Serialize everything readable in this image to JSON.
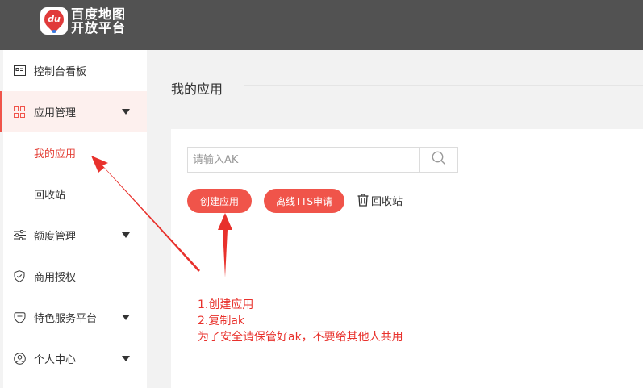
{
  "brand": {
    "logo_badge_text": "du",
    "logo_line1": "百度地图",
    "logo_line2": "开放平台"
  },
  "sidebar": {
    "items": [
      {
        "label": "控制台看板",
        "icon": "dashboard-icon"
      },
      {
        "label": "应用管理",
        "icon": "grid-icon",
        "expanded": true
      },
      {
        "label": "我的应用",
        "selected": true
      },
      {
        "label": "回收站"
      },
      {
        "label": "额度管理",
        "icon": "sliders-icon"
      },
      {
        "label": "商用授权",
        "icon": "shield-icon"
      },
      {
        "label": "特色服务平台",
        "icon": "chat-icon"
      },
      {
        "label": "个人中心",
        "icon": "user-icon"
      }
    ]
  },
  "main": {
    "title": "我的应用",
    "search_placeholder": "请输入AK",
    "create_button": "创建应用",
    "tts_button": "离线TTS申请",
    "recycle_link": "回收站"
  },
  "annotation": {
    "line1": "1.创建应用",
    "line2": "2.复制ak",
    "line3": "为了安全请保管好ak，不要给其他人共用"
  },
  "colors": {
    "accent": "#f0544a",
    "annotation": "#e8312c",
    "topbar": "#525252"
  }
}
